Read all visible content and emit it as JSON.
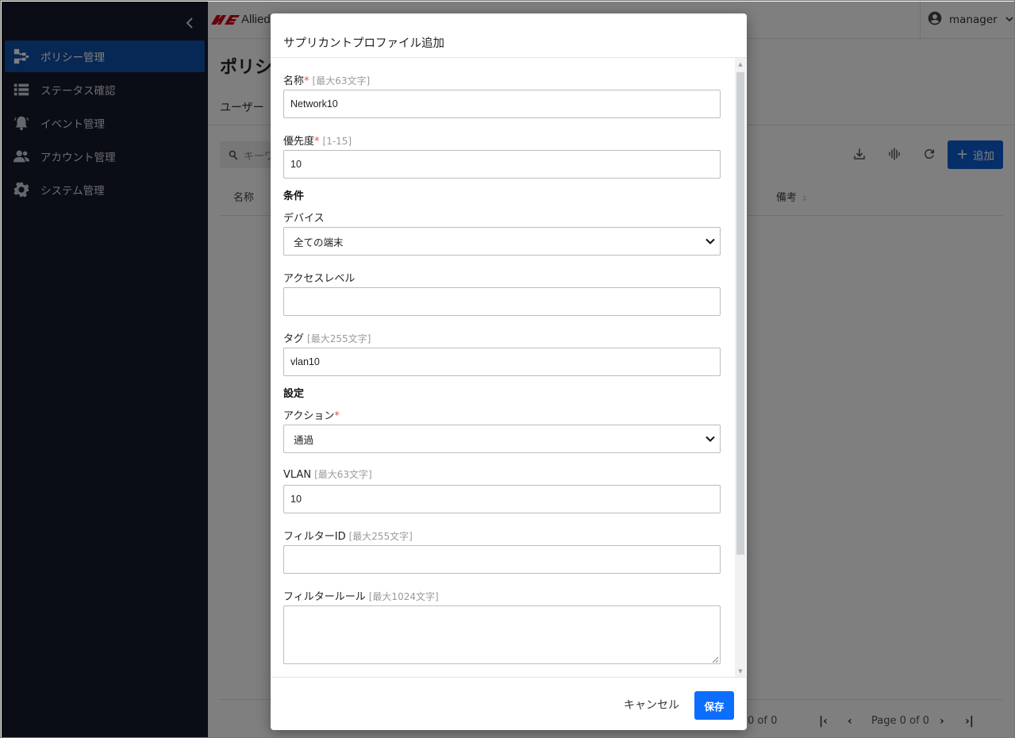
{
  "sidebar": {
    "items": [
      {
        "label": "ポリシー管理",
        "icon": "policy-tree-icon",
        "active": true
      },
      {
        "label": "ステータス確認",
        "icon": "list-icon",
        "active": false
      },
      {
        "label": "イベント管理",
        "icon": "alarm-bell-icon",
        "active": false
      },
      {
        "label": "アカウント管理",
        "icon": "people-icon",
        "active": false
      },
      {
        "label": "システム管理",
        "icon": "gear-icon",
        "active": false
      }
    ]
  },
  "header": {
    "logo_text": "Allied",
    "user_name": "manager"
  },
  "page": {
    "title": "ポリシ",
    "tab_label": "ユーザー",
    "search_placeholder": "キーワ",
    "add_button_label": "追加",
    "columns": {
      "name": "名称",
      "remarks": "備考"
    },
    "pager": {
      "count_text": "0 of 0",
      "page_text": "Page 0 of 0"
    }
  },
  "modal": {
    "title": "サプリカントプロファイル追加",
    "fields": {
      "name": {
        "label": "名称",
        "hint": "[最大63文字]",
        "value": "Network10",
        "required": true
      },
      "priority": {
        "label": "優先度",
        "hint": "[1-15]",
        "value": "10",
        "required": true
      },
      "device": {
        "label": "デバイス",
        "value": "全ての端末"
      },
      "access_level": {
        "label": "アクセスレベル",
        "value": ""
      },
      "tag": {
        "label": "タグ",
        "hint": "[最大255文字]",
        "value": "vlan10"
      },
      "action": {
        "label": "アクション",
        "value": "通過",
        "required": true
      },
      "vlan": {
        "label": "VLAN",
        "hint": "[最大63文字]",
        "value": "10"
      },
      "filter_id": {
        "label": "フィルターID",
        "hint": "[最大255文字]",
        "value": ""
      },
      "filter_rule": {
        "label": "フィルタールール",
        "hint": "[最大1024文字]",
        "value": ""
      }
    },
    "sections": {
      "conditions": "条件",
      "settings": "設定"
    },
    "required_mark": "*",
    "cancel_label": "キャンセル",
    "save_label": "保存"
  },
  "colors": {
    "sidebar_bg": "#141b2b",
    "sidebar_active": "#0f4fa8",
    "primary": "#0d6efd",
    "required": "#d9534f"
  }
}
